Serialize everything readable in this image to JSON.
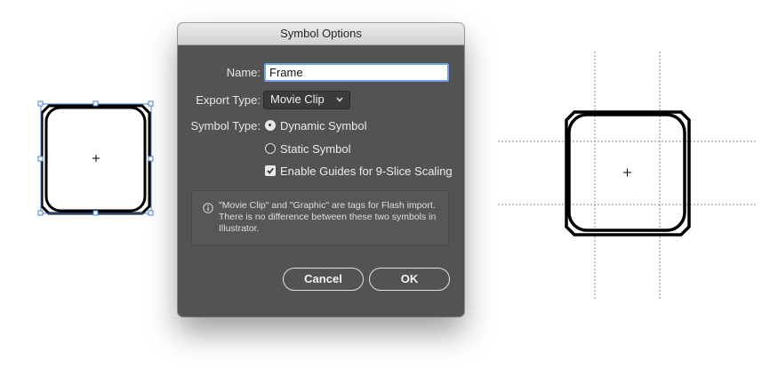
{
  "dialog": {
    "title": "Symbol Options",
    "name_label": "Name:",
    "name_value": "Frame",
    "export_type_label": "Export Type:",
    "export_type_value": "Movie Clip",
    "symbol_type_label": "Symbol Type:",
    "symbol_types": [
      {
        "label": "Dynamic Symbol",
        "selected": true
      },
      {
        "label": "Static Symbol",
        "selected": false
      }
    ],
    "guides_label": "Enable Guides for 9-Slice Scaling",
    "guides_checked": true,
    "info_text": "\"Movie Clip\" and \"Graphic\" are tags for Flash import. There is no difference between these two symbols in Illustrator.",
    "cancel_label": "Cancel",
    "ok_label": "OK"
  },
  "icons": [
    "chevron-down-icon",
    "info-icon",
    "checkmark-icon"
  ],
  "colors": {
    "dialog_bg": "#535353",
    "titlebar_bg": "#dcdcdc",
    "input_focus": "#6ea1e6",
    "selection_blue": "#4a7fd0",
    "guide_line": "#8c8c8c",
    "artwork_stroke": "#000000"
  }
}
